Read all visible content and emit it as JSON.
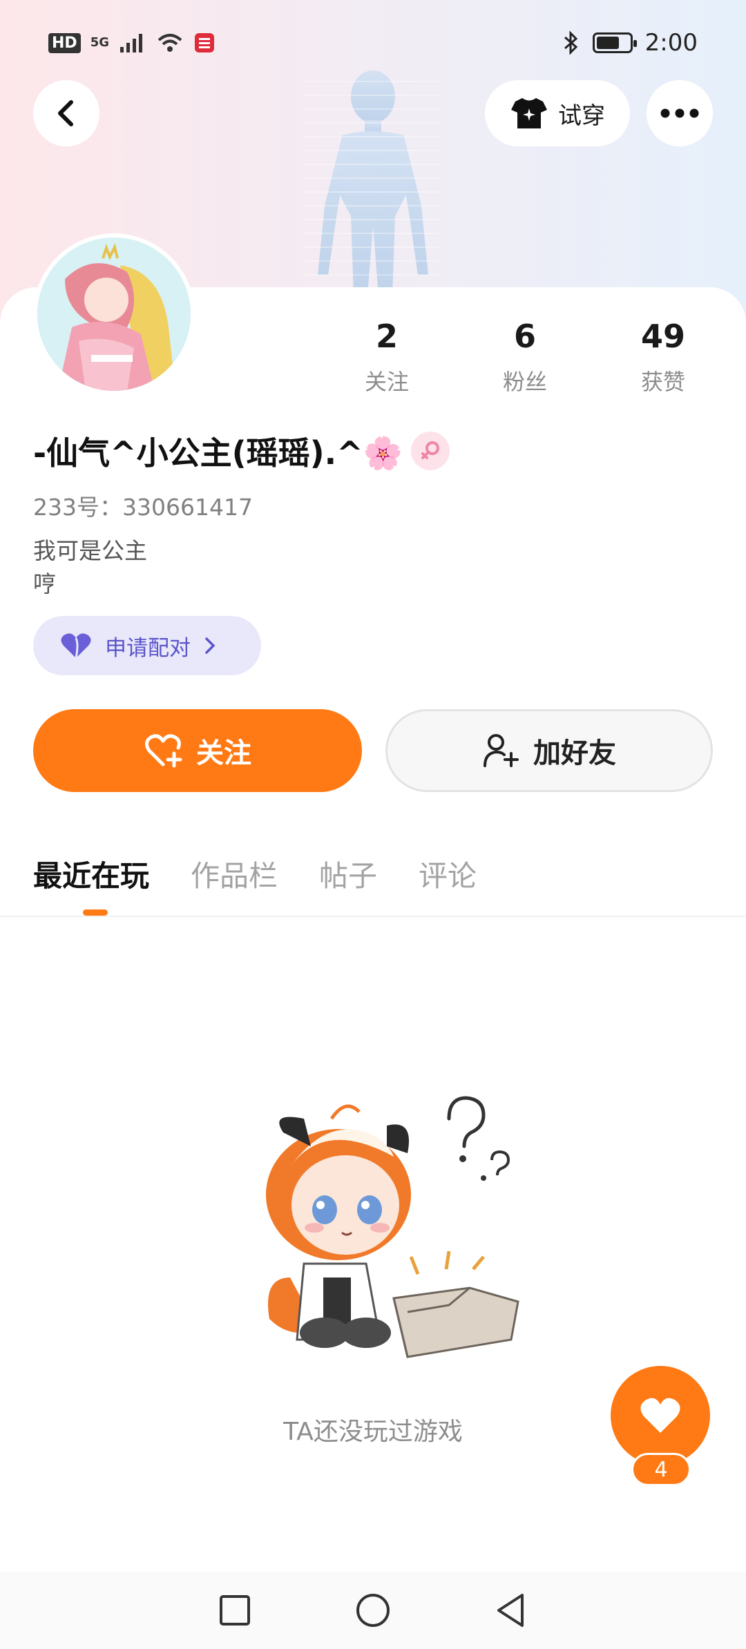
{
  "status_bar": {
    "network_hd": "HD",
    "network_5g": "5G",
    "time": "2:00",
    "battery_percent": 65
  },
  "header": {
    "try_on_label": "试穿",
    "back_icon": "back-arrow-icon",
    "more_icon": "more-dots-icon"
  },
  "stats": [
    {
      "value": "2",
      "label": "关注"
    },
    {
      "value": "6",
      "label": "粉丝"
    },
    {
      "value": "49",
      "label": "获赞"
    }
  ],
  "profile": {
    "nickname": "-仙气^小公主(瑶瑶).^🌸",
    "uid": "233号：330661417",
    "bio_line1": "我可是公主",
    "bio_line2": "哼",
    "pair_label": "申请配对"
  },
  "actions": {
    "follow_label": "关注",
    "add_friend_label": "加好友"
  },
  "tabs": [
    "最近在玩",
    "作品栏",
    "帖子",
    "评论"
  ],
  "empty_state": {
    "message": "TA还没玩过游戏"
  },
  "like": {
    "count": "4"
  },
  "colors": {
    "accent": "#ff7a14",
    "pair_bg": "#e9e8fb",
    "pair_text": "#5a55c8"
  }
}
